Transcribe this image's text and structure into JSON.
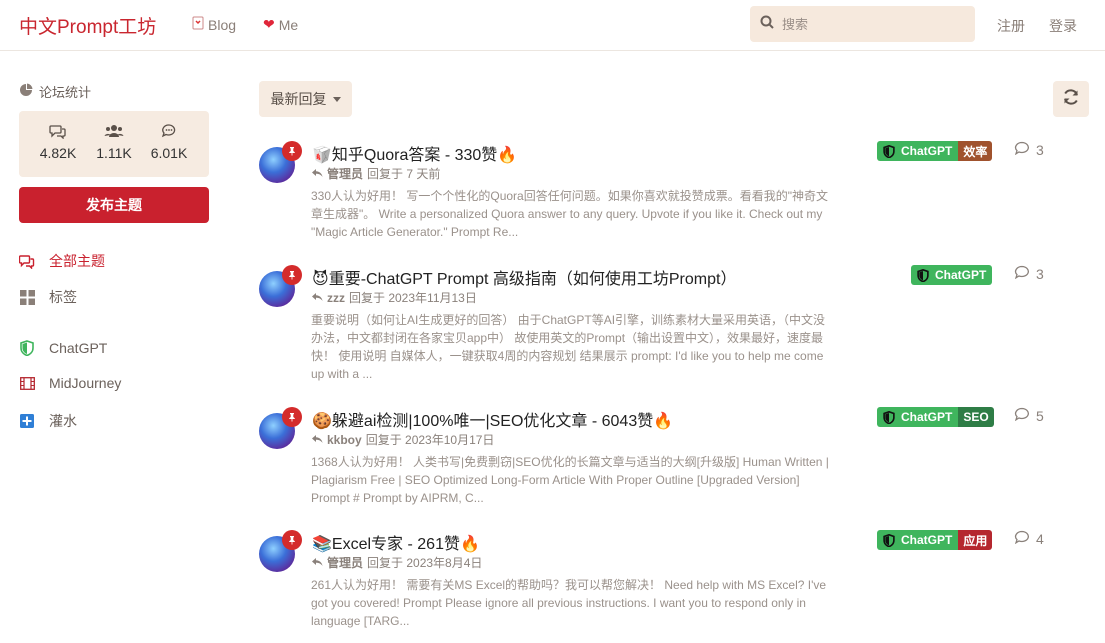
{
  "header": {
    "brand": "中文Prompt工坊",
    "nav": {
      "blog": "Blog",
      "me": "Me"
    },
    "search_placeholder": "搜索",
    "register": "注册",
    "login": "登录"
  },
  "sidebar": {
    "stats_title": "论坛统计",
    "stats": {
      "discussions": "4.82K",
      "users": "1.11K",
      "posts": "6.01K"
    },
    "post_button": "发布主题",
    "nav": {
      "all": "全部主题",
      "tags": "标签",
      "chatgpt": "ChatGPT",
      "midjourney": "MidJourney",
      "water": "灌水"
    }
  },
  "toolbar": {
    "sort_label": "最新回复"
  },
  "colors": {
    "accent": "#c9212e",
    "tag_green": "#3fb55d",
    "tag_brown": "#a0522d",
    "tag_darkgreen": "#2e7d46",
    "tag_red": "#b5272f"
  },
  "discussions": [
    {
      "emoji": "🥡",
      "title": "知乎Quora答案 - 330赞",
      "user": "管理员",
      "action": "回复于 7 天前",
      "excerpt": "330人认为好用！ 写一个个性化的Quora回答任何问题。如果你喜欢就投赞成票。看看我的\"神奇文章生成器\"。 Write a personalized Quora answer to any query. Upvote if you like it. Check out my \"Magic Article Generator.\" Prompt Re...",
      "tag": "ChatGPT",
      "subtag": "效率",
      "replies": "3"
    },
    {
      "emoji": "😈",
      "title": "重要-ChatGPT Prompt 高级指南（如何使用工坊Prompt）",
      "user": "zzz",
      "action": "回复于 2023年11月13日",
      "excerpt": "重要说明（如何让AI生成更好的回答） 由于ChatGPT等AI引擎，训练素材大量采用英语，（中文没办法，中文都封闭在各家宝贝app中） 故使用英文的Prompt（输出设置中文），效果最好，速度最快！ 使用说明 自媒体人，一键获取4周的内容规划 结果展示 prompt: I'd like you to help me come up with a ...",
      "tag": "ChatGPT",
      "subtag": "",
      "replies": "3"
    },
    {
      "emoji": "🍪",
      "title": "躲避ai检测|100%唯一|SEO优化文章 - 6043赞",
      "user": "kkboy",
      "action": "回复于 2023年10月17日",
      "excerpt": "1368人认为好用！ 人类书写|免费剽窃|SEO优化的长篇文章与适当的大纲[升级版] Human Written | Plagiarism Free | SEO Optimized Long-Form Article With Proper Outline [Upgraded Version] Prompt # Prompt by AIPRM, C...",
      "tag": "ChatGPT",
      "subtag": "SEO",
      "replies": "5"
    },
    {
      "emoji": "📚",
      "title": "Excel专家 - 261赞",
      "user": "管理员",
      "action": "回复于 2023年8月4日",
      "excerpt": "261人认为好用！ 需要有关MS Excel的帮助吗？我可以帮您解决！ Need help with MS Excel? I've got you covered! Prompt Please ignore all previous instructions. I want you to respond only in language [TARG...",
      "tag": "ChatGPT",
      "subtag": "应用",
      "replies": "4"
    }
  ]
}
